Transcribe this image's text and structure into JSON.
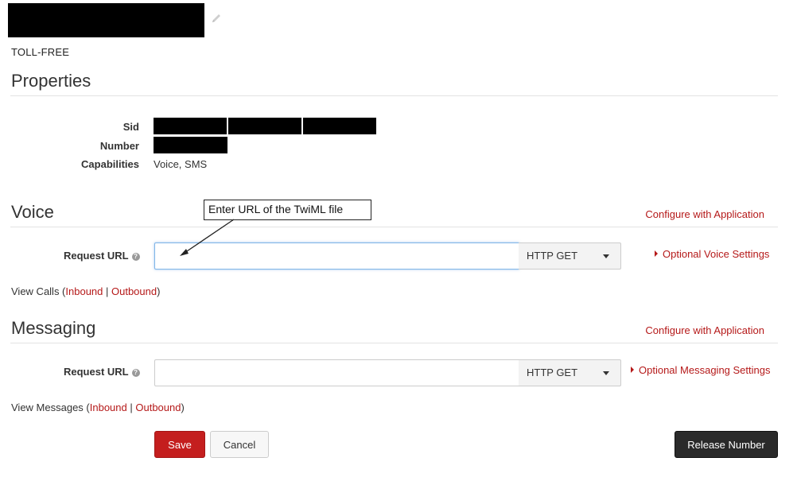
{
  "header": {
    "number_type": "TOLL-FREE",
    "edit_icon": "pencil-icon"
  },
  "properties": {
    "title": "Properties",
    "sid_label": "Sid",
    "number_label": "Number",
    "capabilities_label": "Capabilities",
    "capabilities_value": "Voice, SMS"
  },
  "voice": {
    "title": "Voice",
    "configure_link": "Configure with Application",
    "request_url_label": "Request URL",
    "request_url_value": "",
    "method": "HTTP GET",
    "optional_settings": "Optional Voice Settings",
    "view_prefix": "View Calls (",
    "inbound": "Inbound",
    "separator": " | ",
    "outbound": "Outbound",
    "view_suffix": ")"
  },
  "messaging": {
    "title": "Messaging",
    "configure_link": "Configure with Application",
    "request_url_label": "Request URL",
    "request_url_value": "",
    "method": "HTTP GET",
    "optional_settings": "Optional Messaging Settings",
    "view_prefix": "View Messages (",
    "inbound": "Inbound",
    "separator": " | ",
    "outbound": "Outbound",
    "view_suffix": ")"
  },
  "actions": {
    "save": "Save",
    "cancel": "Cancel",
    "release": "Release Number"
  },
  "annotation": {
    "callout_text": "Enter  URL of the TwiML file"
  },
  "colors": {
    "link": "#b51919",
    "save_button": "#c41e1e",
    "release_button": "#2a2a2a"
  }
}
